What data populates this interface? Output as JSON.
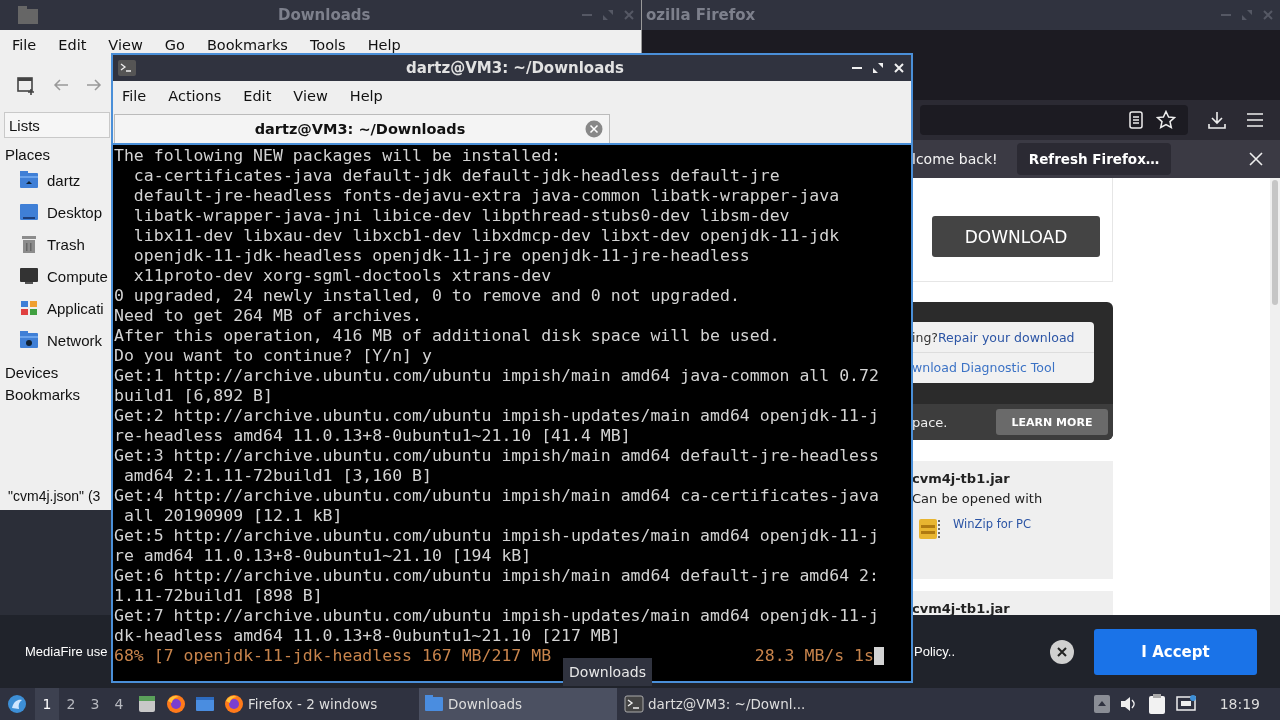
{
  "file_manager": {
    "title": "Downloads",
    "menu": [
      "File",
      "Edit",
      "View",
      "Go",
      "Bookmarks",
      "Tools",
      "Help"
    ],
    "side_tab": "Lists",
    "sections": [
      {
        "label": "Places",
        "items": [
          {
            "label": "dartz",
            "kind": "home"
          },
          {
            "label": "Desktop",
            "kind": "desktop"
          },
          {
            "label": "Trash",
            "kind": "trash"
          },
          {
            "label": "Compute",
            "kind": "computer"
          },
          {
            "label": "Applicati",
            "kind": "apps"
          },
          {
            "label": "Network",
            "kind": "network"
          }
        ]
      },
      {
        "label": "Devices"
      },
      {
        "label": "Bookmarks"
      }
    ],
    "status": "\"cvm4j.json\" (3"
  },
  "firefox": {
    "title": "ozilla Firefox",
    "notification": {
      "message": "lcome back!",
      "button": "Refresh Firefox…"
    },
    "page": {
      "download_button": "DOWNLOAD",
      "help_box": {
        "prefix": "ing? ",
        "link": "Repair your download",
        "tool_link": "wnload Diagnostic Tool",
        "footer": "pace.",
        "button": "LEARN MORE"
      },
      "files": [
        {
          "name": "cvm4j-tb1.jar",
          "note": "Can be opened with",
          "app": "WinZip for PC"
        },
        {
          "name": "cvm4j-tb1.jar"
        }
      ]
    }
  },
  "terminal": {
    "title": "dartz@VM3: ~/Downloads",
    "menu": [
      "File",
      "Actions",
      "Edit",
      "View",
      "Help"
    ],
    "tab": "dartz@VM3: ~/Downloads",
    "lines": [
      "The following NEW packages will be installed:",
      "  ca-certificates-java default-jdk default-jdk-headless default-jre",
      "  default-jre-headless fonts-dejavu-extra java-common libatk-wrapper-java",
      "  libatk-wrapper-java-jni libice-dev libpthread-stubs0-dev libsm-dev",
      "  libx11-dev libxau-dev libxcb1-dev libxdmcp-dev libxt-dev openjdk-11-jdk",
      "  openjdk-11-jdk-headless openjdk-11-jre openjdk-11-jre-headless",
      "  x11proto-dev xorg-sgml-doctools xtrans-dev",
      "0 upgraded, 24 newly installed, 0 to remove and 0 not upgraded.",
      "Need to get 264 MB of archives.",
      "After this operation, 416 MB of additional disk space will be used.",
      "Do you want to continue? [Y/n] y",
      "Get:1 http://archive.ubuntu.com/ubuntu impish/main amd64 java-common all 0.72",
      "build1 [6,892 B]",
      "Get:2 http://archive.ubuntu.com/ubuntu impish-updates/main amd64 openjdk-11-j",
      "re-headless amd64 11.0.13+8-0ubuntu1~21.10 [41.4 MB]",
      "Get:3 http://archive.ubuntu.com/ubuntu impish/main amd64 default-jre-headless",
      " amd64 2:1.11-72build1 [3,160 B]",
      "Get:4 http://archive.ubuntu.com/ubuntu impish/main amd64 ca-certificates-java",
      " all 20190909 [12.1 kB]",
      "Get:5 http://archive.ubuntu.com/ubuntu impish-updates/main amd64 openjdk-11-j",
      "re amd64 11.0.13+8-0ubuntu1~21.10 [194 kB]",
      "Get:6 http://archive.ubuntu.com/ubuntu impish/main amd64 default-jre amd64 2:",
      "1.11-72build1 [898 B]",
      "Get:7 http://archive.ubuntu.com/ubuntu impish-updates/main amd64 openjdk-11-j",
      "dk-headless amd64 11.0.13+8-0ubuntu1~21.10 [217 MB]"
    ],
    "progress": "68% [7 openjdk-11-jdk-headless 167 MB/217 MB",
    "speed": "28.3 MB/s 1s"
  },
  "cookie_banner": {
    "text": "MediaFire use",
    "policy": "Policy..",
    "button": "I Accept"
  },
  "tooltip": "Downloads",
  "taskbar": {
    "workspaces": [
      {
        "label": "1",
        "selected": true
      },
      {
        "label": "2",
        "selected": false
      },
      {
        "label": "3",
        "selected": false
      },
      {
        "label": "4",
        "selected": false
      }
    ],
    "tasks": [
      {
        "label": "Firefox - 2 windows",
        "kind": "firefox",
        "active": false
      },
      {
        "label": "Downloads",
        "kind": "folder",
        "active": true
      },
      {
        "label": "dartz@VM3: ~/Downl...",
        "kind": "terminal",
        "active": false
      }
    ],
    "clock": "18:19"
  }
}
